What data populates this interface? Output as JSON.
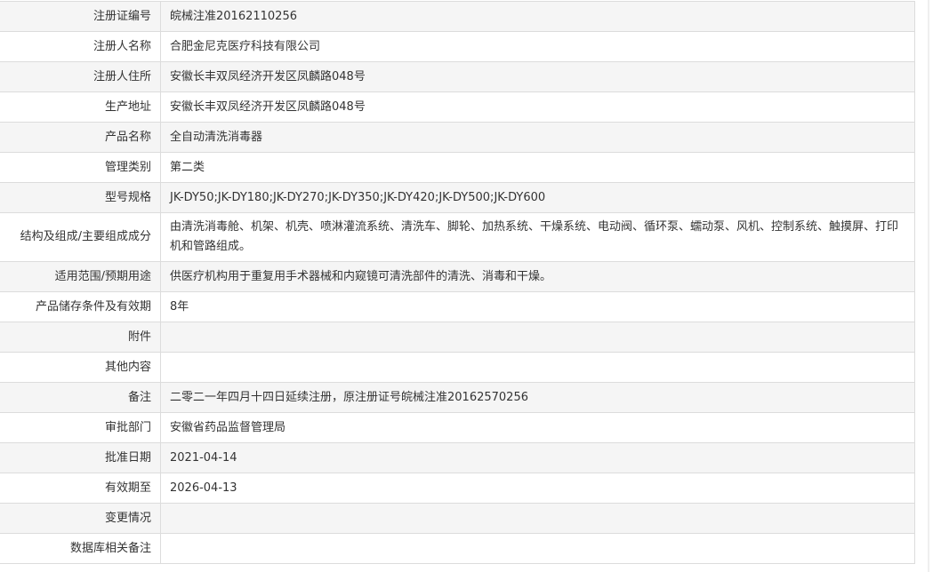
{
  "rows": [
    {
      "label": "注册证编号",
      "value": "皖械注准20162110256"
    },
    {
      "label": "注册人名称",
      "value": "合肥金尼克医疗科技有限公司"
    },
    {
      "label": "注册人住所",
      "value": "安徽长丰双凤经济开发区凤麟路048号"
    },
    {
      "label": "生产地址",
      "value": "安徽长丰双凤经济开发区凤麟路048号"
    },
    {
      "label": "产品名称",
      "value": "全自动清洗消毒器"
    },
    {
      "label": "管理类别",
      "value": "第二类"
    },
    {
      "label": "型号规格",
      "value": "JK-DY50;JK-DY180;JK-DY270;JK-DY350;JK-DY420;JK-DY500;JK-DY600"
    },
    {
      "label": "结构及组成/主要组成成分",
      "value": "由清洗消毒舱、机架、机壳、喷淋灌流系统、清洗车、脚轮、加热系统、干燥系统、电动阀、循环泵、蠕动泵、风机、控制系统、触摸屏、打印机和管路组成。"
    },
    {
      "label": "适用范围/预期用途",
      "value": "供医疗机构用于重复用手术器械和内窥镜可清洗部件的清洗、消毒和干燥。"
    },
    {
      "label": "产品储存条件及有效期",
      "value": "8年"
    },
    {
      "label": "附件",
      "value": ""
    },
    {
      "label": "其他内容",
      "value": ""
    },
    {
      "label": "备注",
      "value": "二零二一年四月十四日延续注册，原注册证号皖械注准20162570256"
    },
    {
      "label": "审批部门",
      "value": "安徽省药品监督管理局"
    },
    {
      "label": "批准日期",
      "value": "2021-04-14"
    },
    {
      "label": "有效期至",
      "value": "2026-04-13"
    },
    {
      "label": "变更情况",
      "value": ""
    },
    {
      "label": "数据库相关备注",
      "value": ""
    }
  ]
}
